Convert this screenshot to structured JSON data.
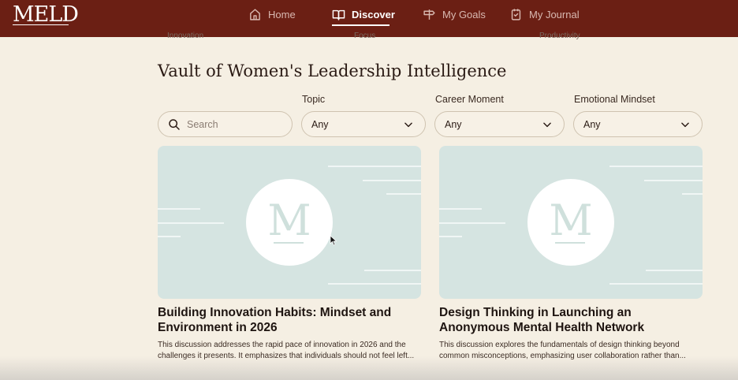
{
  "app": {
    "logo": "MELD"
  },
  "nav": {
    "items": [
      {
        "label": "Home",
        "icon": "home-icon"
      },
      {
        "label": "Discover",
        "icon": "book-icon",
        "active": true
      },
      {
        "label": "My Goals",
        "icon": "signpost-icon"
      },
      {
        "label": "My Journal",
        "icon": "journal-icon"
      }
    ]
  },
  "cut_labels": [
    "Innovation",
    "Focus",
    "Productivity"
  ],
  "section": {
    "title": "Vault of Women's Leadership Intelligence"
  },
  "filters": {
    "search_placeholder": "Search",
    "topic": {
      "label": "Topic",
      "value": "Any"
    },
    "career_moment": {
      "label": "Career Moment",
      "value": "Any"
    },
    "emotional_mindset": {
      "label": "Emotional Mindset",
      "value": "Any"
    }
  },
  "cards": [
    {
      "logo_letter": "M",
      "title": "Building Innovation Habits: Mindset and Environment in 2026",
      "description": "This discussion addresses the rapid pace of innovation in 2026 and the challenges it presents. It emphasizes that individuals should not feel left..."
    },
    {
      "logo_letter": "M",
      "title": "Design Thinking in Launching an Anonymous Mental Health Network",
      "description": "This discussion explores the fundamentals of design thinking beyond common misconceptions, emphasizing user collaboration rather than..."
    }
  ],
  "colors": {
    "header_bg": "#6b1f14",
    "page_bg": "#f5efe3",
    "card_bg": "#d5e4e1"
  }
}
